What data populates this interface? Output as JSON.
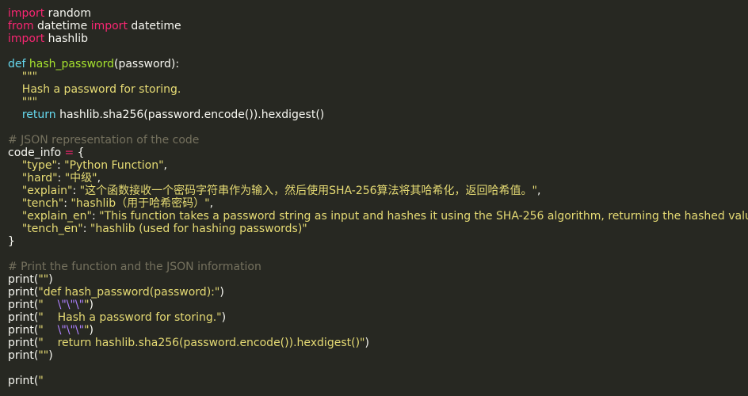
{
  "colors": {
    "background": "#272822",
    "text": "#f8f8f2",
    "keyword": "#f92672",
    "storage": "#66d9ef",
    "function": "#a6e22e",
    "string": "#e6db74",
    "comment": "#75715e",
    "escape": "#ae81ff"
  },
  "code": {
    "lines": [
      [
        [
          "kw",
          "import"
        ],
        [
          "pl",
          " random"
        ]
      ],
      [
        [
          "kw",
          "from"
        ],
        [
          "pl",
          " datetime "
        ],
        [
          "kw",
          "import"
        ],
        [
          "pl",
          " datetime"
        ]
      ],
      [
        [
          "kw",
          "import"
        ],
        [
          "pl",
          " hashlib"
        ]
      ],
      [],
      [
        [
          "def",
          "def "
        ],
        [
          "fn",
          "hash_password"
        ],
        [
          "pl",
          "(password):"
        ]
      ],
      [
        [
          "str",
          "    \"\"\""
        ]
      ],
      [
        [
          "str",
          "    Hash a password for storing."
        ]
      ],
      [
        [
          "str",
          "    \"\"\""
        ]
      ],
      [
        [
          "pl",
          "    "
        ],
        [
          "def",
          "return"
        ],
        [
          "pl",
          " hashlib.sha256(password.encode()).hexdigest()"
        ]
      ],
      [],
      [
        [
          "cmt",
          "# JSON representation of the code"
        ]
      ],
      [
        [
          "pl",
          "code_info "
        ],
        [
          "kw",
          "="
        ],
        [
          "pl",
          " {"
        ]
      ],
      [
        [
          "pl",
          "    "
        ],
        [
          "str",
          "\"type\""
        ],
        [
          "pl",
          ": "
        ],
        [
          "str",
          "\"Python Function\""
        ],
        [
          "pl",
          ","
        ]
      ],
      [
        [
          "pl",
          "    "
        ],
        [
          "str",
          "\"hard\""
        ],
        [
          "pl",
          ": "
        ],
        [
          "str",
          "\"中级\""
        ],
        [
          "pl",
          ","
        ]
      ],
      [
        [
          "pl",
          "    "
        ],
        [
          "str",
          "\"explain\""
        ],
        [
          "pl",
          ": "
        ],
        [
          "str",
          "\"这个函数接收一个密码字符串作为输入，然后使用SHA-256算法将其哈希化，返回哈希值。\""
        ],
        [
          "pl",
          ","
        ]
      ],
      [
        [
          "pl",
          "    "
        ],
        [
          "str",
          "\"tench\""
        ],
        [
          "pl",
          ": "
        ],
        [
          "str",
          "\"hashlib（用于哈希密码）\""
        ],
        [
          "pl",
          ","
        ]
      ],
      [
        [
          "pl",
          "    "
        ],
        [
          "str",
          "\"explain_en\""
        ],
        [
          "pl",
          ": "
        ],
        [
          "str",
          "\"This function takes a password string as input and hashes it using the SHA-256 algorithm, returning the hashed value.\""
        ],
        [
          "pl",
          ","
        ]
      ],
      [
        [
          "pl",
          "    "
        ],
        [
          "str",
          "\"tench_en\""
        ],
        [
          "pl",
          ": "
        ],
        [
          "str",
          "\"hashlib (used for hashing passwords)\""
        ]
      ],
      [
        [
          "pl",
          "}"
        ]
      ],
      [],
      [
        [
          "cmt",
          "# Print the function and the JSON information"
        ]
      ],
      [
        [
          "pl",
          "print("
        ],
        [
          "str",
          "\"\""
        ],
        [
          "pl",
          ")"
        ]
      ],
      [
        [
          "pl",
          "print("
        ],
        [
          "str",
          "\"def hash_password(password):\""
        ],
        [
          "pl",
          ")"
        ]
      ],
      [
        [
          "pl",
          "print("
        ],
        [
          "str",
          "\"    "
        ],
        [
          "esc",
          "\\\"\\\"\\\""
        ],
        [
          "str",
          "\""
        ],
        [
          "pl",
          ")"
        ]
      ],
      [
        [
          "pl",
          "print("
        ],
        [
          "str",
          "\"    Hash a password for storing.\""
        ],
        [
          "pl",
          ")"
        ]
      ],
      [
        [
          "pl",
          "print("
        ],
        [
          "str",
          "\"    "
        ],
        [
          "esc",
          "\\\"\\\"\\\""
        ],
        [
          "str",
          "\""
        ],
        [
          "pl",
          ")"
        ]
      ],
      [
        [
          "pl",
          "print("
        ],
        [
          "str",
          "\"    return hashlib.sha256(password.encode()).hexdigest()\""
        ],
        [
          "pl",
          ")"
        ]
      ],
      [
        [
          "pl",
          "print("
        ],
        [
          "str",
          "\"\""
        ],
        [
          "pl",
          ")"
        ]
      ],
      [],
      [
        [
          "pl",
          "print("
        ],
        [
          "str",
          "\""
        ]
      ]
    ]
  }
}
